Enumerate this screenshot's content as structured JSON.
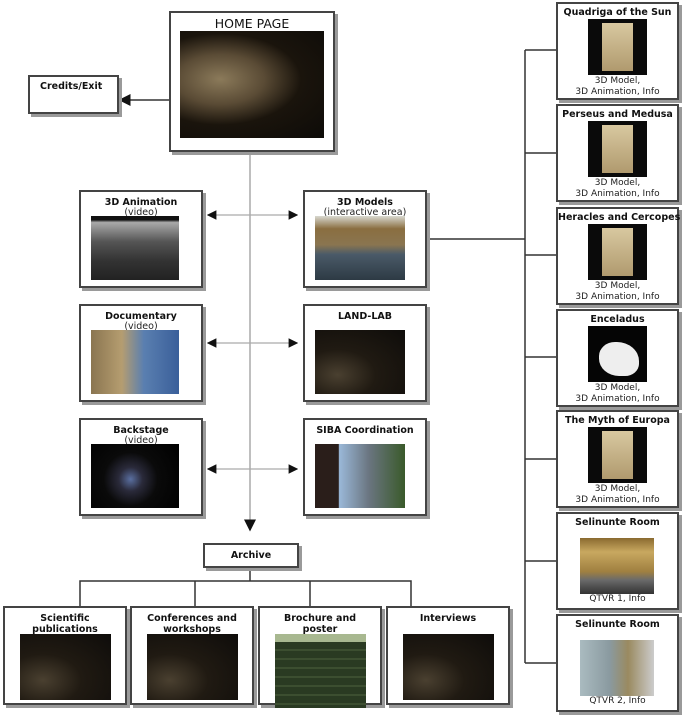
{
  "home": {
    "title": "HOME PAGE"
  },
  "credits": {
    "title": "Credits/Exit"
  },
  "sections": [
    {
      "title": "3D Animation",
      "sub": "(video)"
    },
    {
      "title": "3D Models",
      "sub": "(interactive area)"
    },
    {
      "title": "Documentary",
      "sub": "(video)"
    },
    {
      "title": "LAND-LAB",
      "sub": ""
    },
    {
      "title": "Backstage",
      "sub": "(video)"
    },
    {
      "title": "SIBA Coordination",
      "sub": ""
    }
  ],
  "archive": {
    "title": "Archive",
    "items": [
      {
        "title": "Scientific publications"
      },
      {
        "title": "Conferences and workshops"
      },
      {
        "title": "Brochure and poster"
      },
      {
        "title": "Interviews"
      }
    ]
  },
  "models": [
    {
      "title": "Quadriga of the Sun",
      "caption": "3D Model,\n3D Animation, Info"
    },
    {
      "title": "Perseus and Medusa",
      "caption": "3D Model,\n3D Animation, Info"
    },
    {
      "title": "Heracles and Cercopes",
      "caption": "3D Model,\n3D Animation, Info"
    },
    {
      "title": "Enceladus",
      "caption": "3D Model,\n3D Animation, Info"
    },
    {
      "title": "The Myth of Europa",
      "caption": "3D Model,\n3D Animation, Info"
    },
    {
      "title": "Selinunte Room",
      "caption": "QTVR 1, Info"
    },
    {
      "title": "Selinunte Room",
      "caption": "QTVR 2, Info"
    }
  ],
  "colors": {
    "border": "#444444",
    "connector": "#333333",
    "trunk": "#aaaaaa"
  }
}
